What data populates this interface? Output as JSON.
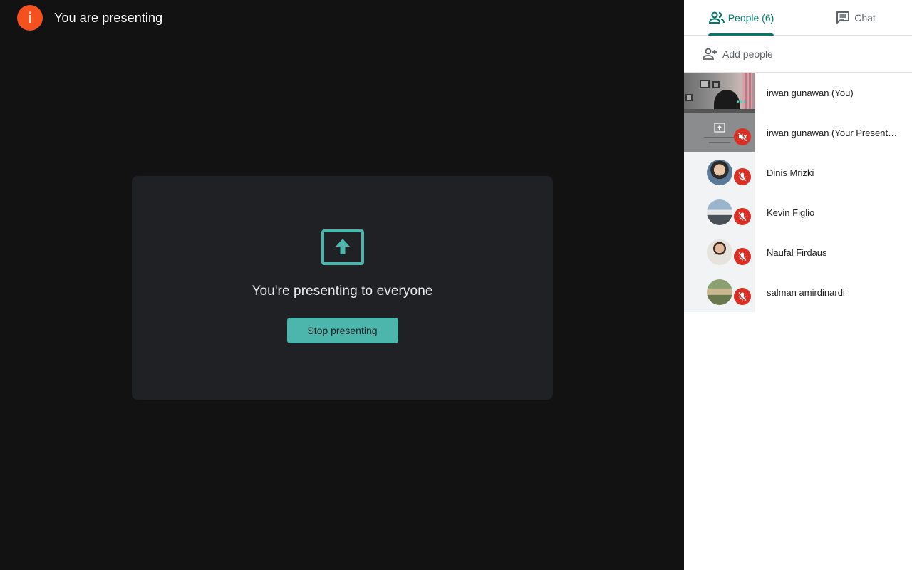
{
  "stage": {
    "info_letter": "i",
    "title": "You are presenting",
    "presenting_message": "You're presenting to everyone",
    "stop_button_label": "Stop presenting"
  },
  "panel": {
    "tabs": [
      {
        "label": "People (6)",
        "icon": "people-icon",
        "active": true
      },
      {
        "label": "Chat",
        "icon": "chat-icon",
        "active": false
      }
    ],
    "add_people_label": "Add people",
    "people": [
      {
        "name": "irwan gunawan (You)",
        "thumb": "camera-video",
        "muted": false
      },
      {
        "name": "irwan gunawan (Your Presentation)",
        "thumb": "screen-share",
        "muted": true,
        "mute_icon": "speaker-off-icon"
      },
      {
        "name": "Dinis Mrizki",
        "thumb": "avatar",
        "muted": true,
        "mute_icon": "mic-off-icon"
      },
      {
        "name": "Kevin Figlio",
        "thumb": "avatar",
        "muted": true,
        "mute_icon": "mic-off-icon"
      },
      {
        "name": "Naufal Firdaus",
        "thumb": "avatar",
        "muted": true,
        "mute_icon": "mic-off-icon"
      },
      {
        "name": "salman amirdinardi",
        "thumb": "avatar",
        "muted": true,
        "mute_icon": "mic-off-icon"
      }
    ]
  },
  "colors": {
    "accent": "#00796b",
    "present_teal": "#4db6ac",
    "info_badge": "#f4511e",
    "mute_red": "#d93025"
  }
}
